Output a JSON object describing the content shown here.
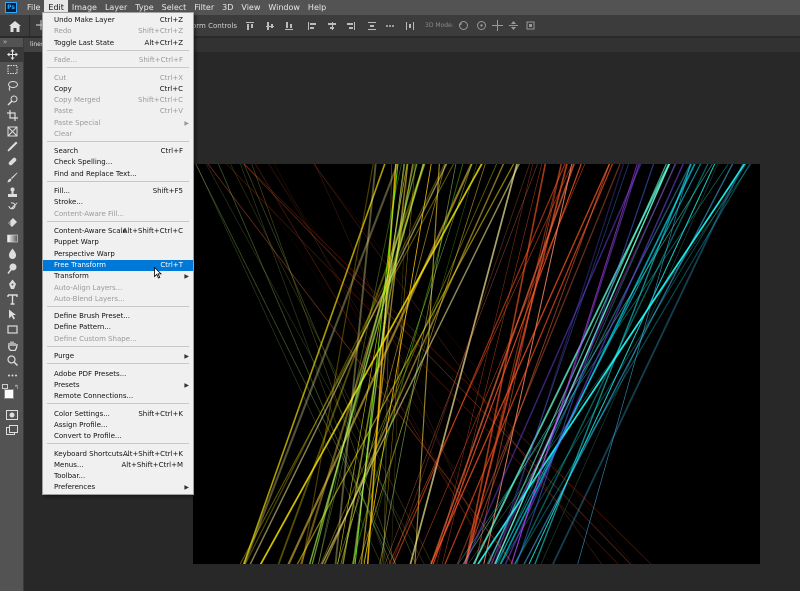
{
  "menubar": {
    "logo": "Ps",
    "items": [
      "File",
      "Edit",
      "Image",
      "Layer",
      "Type",
      "Select",
      "Filter",
      "3D",
      "View",
      "Window",
      "Help"
    ],
    "active": "Edit"
  },
  "options_bar": {
    "transform_controls": "orm Controls",
    "mode_3d": "3D Mode:"
  },
  "document": {
    "tab_label": "lines..."
  },
  "edit_menu": {
    "items": [
      {
        "label": "Undo Make Layer",
        "shortcut": "Ctrl+Z",
        "enabled": true
      },
      {
        "label": "Redo",
        "shortcut": "Shift+Ctrl+Z",
        "enabled": false
      },
      {
        "label": "Toggle Last State",
        "shortcut": "Alt+Ctrl+Z",
        "enabled": true
      },
      {
        "label": "Fade...",
        "shortcut": "Shift+Ctrl+F",
        "enabled": false
      },
      {
        "label": "Cut",
        "shortcut": "Ctrl+X",
        "enabled": false
      },
      {
        "label": "Copy",
        "shortcut": "Ctrl+C",
        "enabled": true
      },
      {
        "label": "Copy Merged",
        "shortcut": "Shift+Ctrl+C",
        "enabled": false
      },
      {
        "label": "Paste",
        "shortcut": "Ctrl+V",
        "enabled": false
      },
      {
        "label": "Paste Special",
        "shortcut": "",
        "enabled": false,
        "submenu": true
      },
      {
        "label": "Clear",
        "shortcut": "",
        "enabled": false
      },
      {
        "label": "Search",
        "shortcut": "Ctrl+F",
        "enabled": true
      },
      {
        "label": "Check Spelling...",
        "shortcut": "",
        "enabled": true
      },
      {
        "label": "Find and Replace Text...",
        "shortcut": "",
        "enabled": true
      },
      {
        "label": "Fill...",
        "shortcut": "Shift+F5",
        "enabled": true
      },
      {
        "label": "Stroke...",
        "shortcut": "",
        "enabled": true
      },
      {
        "label": "Content-Aware Fill...",
        "shortcut": "",
        "enabled": false
      },
      {
        "label": "Content-Aware Scale",
        "shortcut": "Alt+Shift+Ctrl+C",
        "enabled": true
      },
      {
        "label": "Puppet Warp",
        "shortcut": "",
        "enabled": true
      },
      {
        "label": "Perspective Warp",
        "shortcut": "",
        "enabled": true
      },
      {
        "label": "Free Transform",
        "shortcut": "Ctrl+T",
        "enabled": true,
        "highlighted": true
      },
      {
        "label": "Transform",
        "shortcut": "",
        "enabled": true,
        "submenu": true
      },
      {
        "label": "Auto-Align Layers...",
        "shortcut": "",
        "enabled": false
      },
      {
        "label": "Auto-Blend Layers...",
        "shortcut": "",
        "enabled": false
      },
      {
        "label": "Define Brush Preset...",
        "shortcut": "",
        "enabled": true
      },
      {
        "label": "Define Pattern...",
        "shortcut": "",
        "enabled": true
      },
      {
        "label": "Define Custom Shape...",
        "shortcut": "",
        "enabled": false
      },
      {
        "label": "Purge",
        "shortcut": "",
        "enabled": true,
        "submenu": true
      },
      {
        "label": "Adobe PDF Presets...",
        "shortcut": "",
        "enabled": true
      },
      {
        "label": "Presets",
        "shortcut": "",
        "enabled": true,
        "submenu": true
      },
      {
        "label": "Remote Connections...",
        "shortcut": "",
        "enabled": true
      },
      {
        "label": "Color Settings...",
        "shortcut": "Shift+Ctrl+K",
        "enabled": true
      },
      {
        "label": "Assign Profile...",
        "shortcut": "",
        "enabled": true
      },
      {
        "label": "Convert to Profile...",
        "shortcut": "",
        "enabled": true
      },
      {
        "label": "Keyboard Shortcuts...",
        "shortcut": "Alt+Shift+Ctrl+K",
        "enabled": true
      },
      {
        "label": "Menus...",
        "shortcut": "Alt+Shift+Ctrl+M",
        "enabled": true
      },
      {
        "label": "Toolbar...",
        "shortcut": "",
        "enabled": true
      },
      {
        "label": "Preferences",
        "shortcut": "",
        "enabled": true,
        "submenu": true
      }
    ]
  },
  "toolbar": {
    "tools": [
      "move-tool",
      "marquee-tool",
      "lasso-tool",
      "quick-select-tool",
      "crop-tool",
      "frame-tool",
      "eyedropper-tool",
      "healing-tool",
      "brush-tool",
      "clone-stamp-tool",
      "history-brush-tool",
      "eraser-tool",
      "gradient-tool",
      "blur-tool",
      "dodge-tool",
      "pen-tool",
      "type-tool",
      "path-select-tool",
      "rectangle-tool",
      "hand-tool",
      "zoom-tool",
      "more-tools"
    ]
  },
  "colors": {
    "foreground": "#ffffff",
    "background": "#000000",
    "menu_highlight": "#0078d7"
  }
}
